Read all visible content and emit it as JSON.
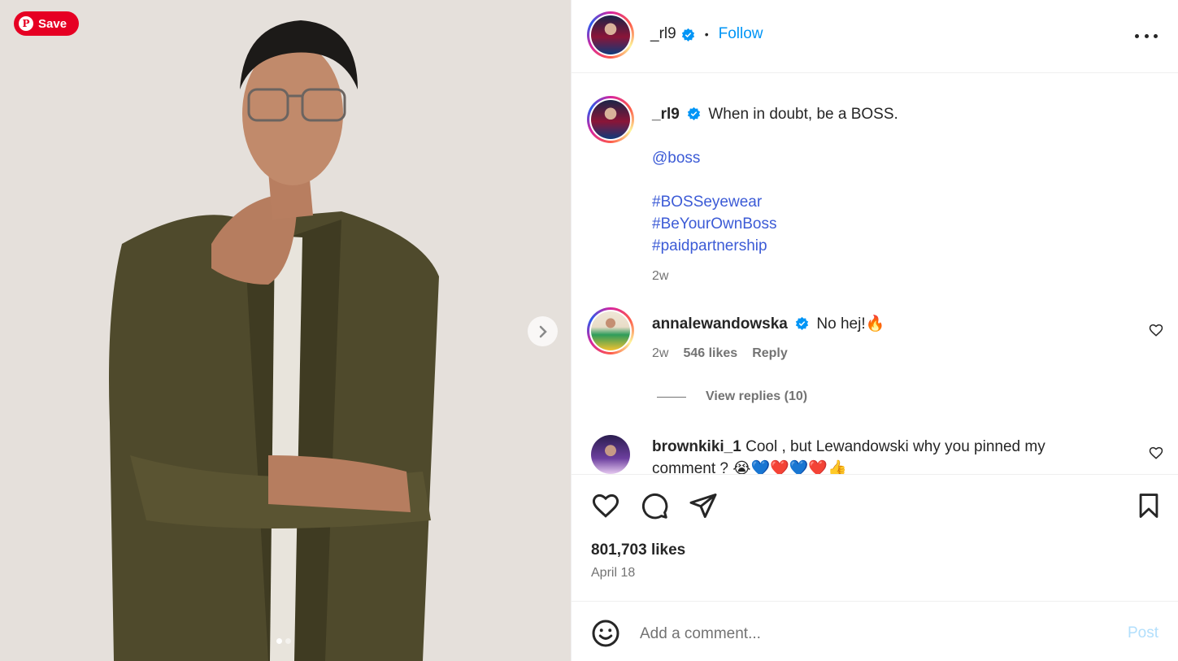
{
  "pin": {
    "save_label": "Save"
  },
  "carousel": {
    "slides": 2,
    "active": 1
  },
  "post": {
    "author": "_rl9",
    "follow_label": "Follow",
    "separator": "•",
    "caption_text": "When in doubt, be a BOSS.",
    "mention": "@boss",
    "hashtags": [
      "#BOSSeyewear",
      "#BeYourOwnBoss",
      "#paidpartnership"
    ],
    "age": "2w"
  },
  "comments": [
    {
      "username": "annalewandowska",
      "text": "No hej!🔥",
      "age": "2w",
      "likes": "546 likes",
      "reply_label": "Reply",
      "view_replies": "View replies (10)"
    },
    {
      "username": "brownkiki_1",
      "text": "Cool , but Lewandowski why you pinned my comment ? 😭💙❤️💙❤️👍"
    }
  ],
  "engagement": {
    "likes": "801,703 likes",
    "date": "April 18"
  },
  "composer": {
    "placeholder": "Add a comment...",
    "post_label": "Post"
  },
  "colors": {
    "accent": "#0095f6",
    "link": "#3c5bd6",
    "pinterest": "#e60023"
  }
}
